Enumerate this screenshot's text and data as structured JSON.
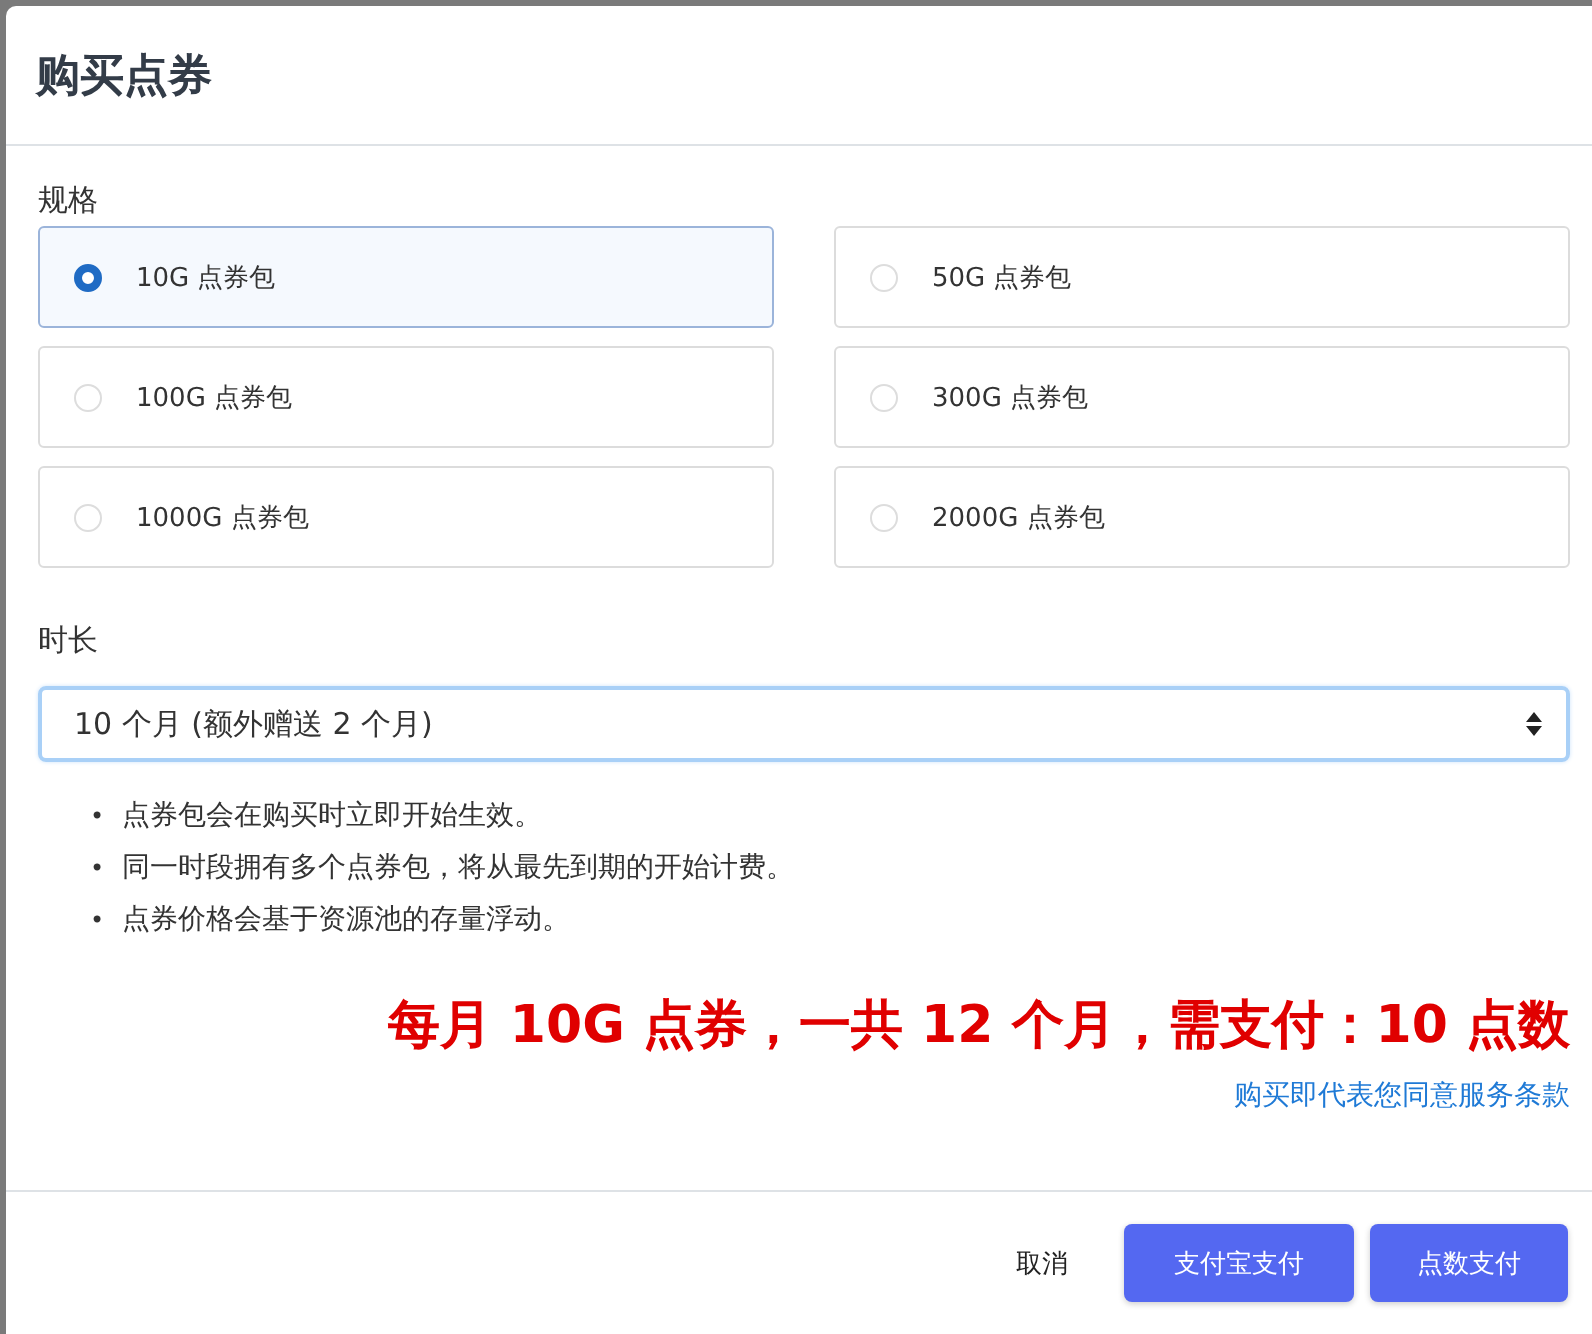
{
  "dialog": {
    "title": "购买点券"
  },
  "spec": {
    "label": "规格",
    "options": [
      {
        "label": "10G 点券包",
        "selected": true
      },
      {
        "label": "50G 点券包",
        "selected": false
      },
      {
        "label": "100G 点券包",
        "selected": false
      },
      {
        "label": "300G 点券包",
        "selected": false
      },
      {
        "label": "1000G 点券包",
        "selected": false
      },
      {
        "label": "2000G 点券包",
        "selected": false
      }
    ]
  },
  "duration": {
    "label": "时长",
    "value": "10 个月 (额外赠送 2 个月)"
  },
  "notes": [
    {
      "bullet": "•",
      "text": "点券包会在购买时立即开始生效。"
    },
    {
      "bullet": "•",
      "text": "同一时段拥有多个点券包，将从最先到期的开始计费。"
    },
    {
      "bullet": "•",
      "text": "点券价格会基于资源池的存量浮动。"
    }
  ],
  "summary": "每月 10G 点券，一共 12 个月，需支付：10 点数",
  "terms_link": "购买即代表您同意服务条款",
  "buttons": [
    {
      "label": "取消",
      "kind": "plain"
    },
    {
      "label": "支付宝支付",
      "kind": "primary"
    },
    {
      "label": "点数支付",
      "kind": "primary"
    }
  ]
}
